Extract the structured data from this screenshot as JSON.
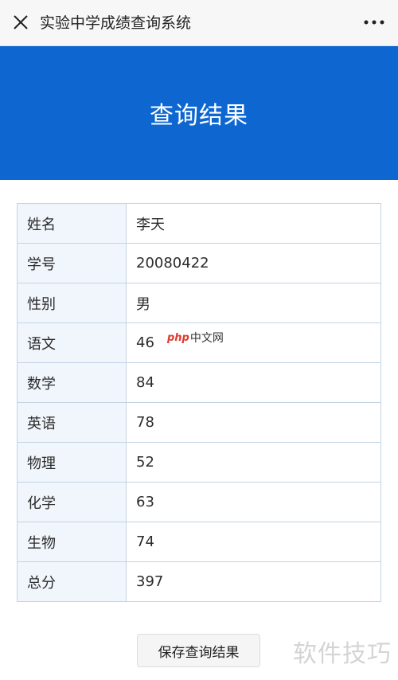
{
  "topbar": {
    "title": "实验中学成绩查询系统",
    "close_icon": "close-icon",
    "more_icon": "more-dots-icon"
  },
  "banner": {
    "title": "查询结果",
    "color": "#0e67d0"
  },
  "results": {
    "rows": [
      {
        "label": "姓名",
        "value": "李天"
      },
      {
        "label": "学号",
        "value": "20080422"
      },
      {
        "label": "性别",
        "value": "男"
      },
      {
        "label": "语文",
        "value": "46"
      },
      {
        "label": "数学",
        "value": "84"
      },
      {
        "label": "英语",
        "value": "78"
      },
      {
        "label": "物理",
        "value": "52"
      },
      {
        "label": "化学",
        "value": "63"
      },
      {
        "label": "生物",
        "value": "74"
      },
      {
        "label": "总分",
        "value": "397"
      }
    ]
  },
  "save_button": {
    "label": "保存查询结果"
  },
  "watermarks": {
    "mid_logo": "php",
    "mid_text": "中文网",
    "corner": "软件技巧"
  }
}
